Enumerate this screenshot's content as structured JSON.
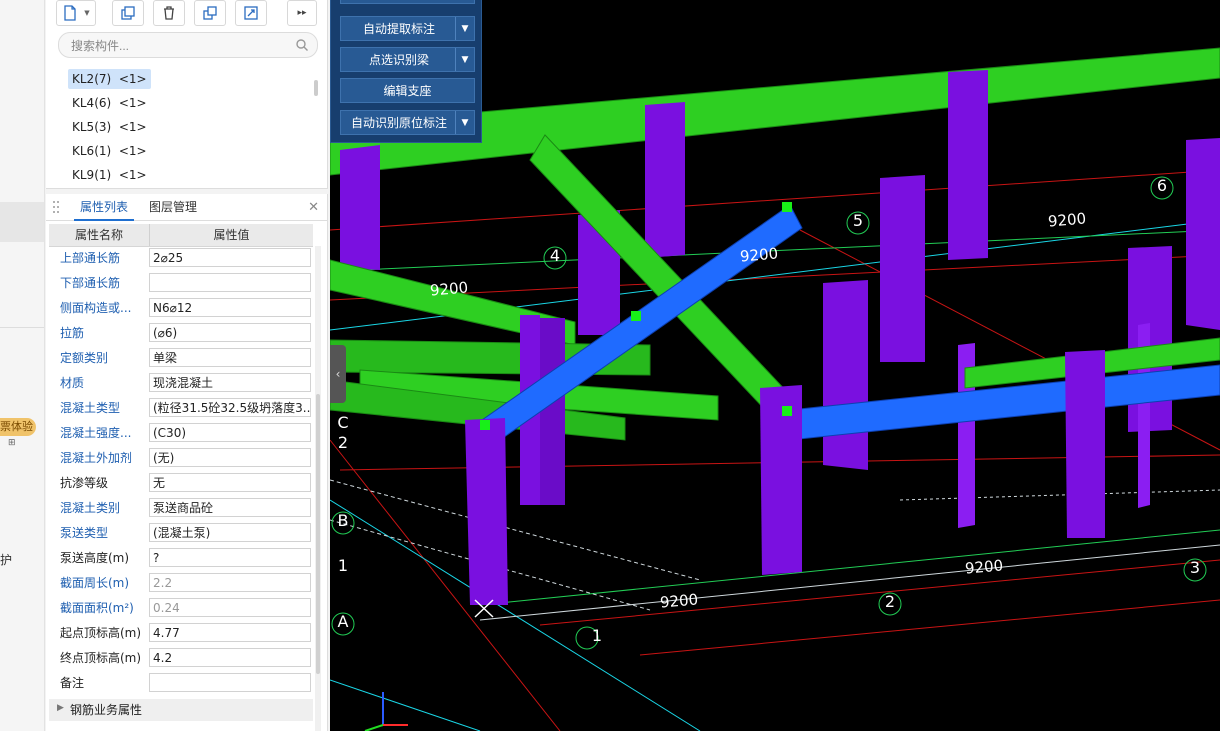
{
  "left_strip": {
    "badge": "票体验",
    "bottom_text": "护"
  },
  "component_panel": {
    "search": {
      "placeholder": "搜索构件..."
    },
    "items": [
      {
        "label": "KL2(7)  <1>",
        "selected": true
      },
      {
        "label": "KL4(6)  <1>",
        "selected": false
      },
      {
        "label": "KL5(3)  <1>",
        "selected": false
      },
      {
        "label": "KL6(1)  <1>",
        "selected": false
      },
      {
        "label": "KL9(1)  <1>",
        "selected": false
      }
    ]
  },
  "property_panel": {
    "tabs": [
      "属性列表",
      "图层管理"
    ],
    "columns": [
      "属性名称",
      "属性值"
    ],
    "rows": [
      {
        "name": "上部通长筋",
        "value": "2⌀25",
        "name_color": "blue"
      },
      {
        "name": "下部通长筋",
        "value": "",
        "name_color": "blue"
      },
      {
        "name": "侧面构造或...",
        "value": "N6⌀12",
        "name_color": "blue"
      },
      {
        "name": "拉筋",
        "value": "(⌀6)",
        "name_color": "blue"
      },
      {
        "name": "定额类别",
        "value": "单梁",
        "name_color": "blue"
      },
      {
        "name": "材质",
        "value": "现浇混凝土",
        "name_color": "blue"
      },
      {
        "name": "混凝土类型",
        "value": "(粒径31.5砼32.5级坍落度3...",
        "name_color": "blue"
      },
      {
        "name": "混凝土强度...",
        "value": "(C30)",
        "name_color": "blue"
      },
      {
        "name": "混凝土外加剂",
        "value": "(无)",
        "name_color": "blue"
      },
      {
        "name": "抗渗等级",
        "value": "无",
        "name_color": "black"
      },
      {
        "name": "混凝土类别",
        "value": "泵送商品砼",
        "name_color": "blue"
      },
      {
        "name": "泵送类型",
        "value": "(混凝土泵)",
        "name_color": "blue"
      },
      {
        "name": "泵送高度(m)",
        "value": "?",
        "name_color": "black"
      },
      {
        "name": "截面周长(m)",
        "value": "2.2",
        "name_color": "blue",
        "value_grey": true
      },
      {
        "name": "截面面积(m²)",
        "value": "0.24",
        "name_color": "blue",
        "value_grey": true
      },
      {
        "name": "起点顶标高(m)",
        "value": "4.77",
        "name_color": "black"
      },
      {
        "name": "终点顶标高(m)",
        "value": "4.2",
        "name_color": "black"
      },
      {
        "name": "备注",
        "value": "",
        "name_color": "black"
      }
    ],
    "sections": [
      "钢筋业务属性"
    ]
  },
  "tool_menu": {
    "buttons": [
      {
        "label": "自动提取标注",
        "dropdown": true
      },
      {
        "label": "点选识别梁",
        "dropdown": true
      },
      {
        "label": "编辑支座",
        "dropdown": false
      },
      {
        "label": "自动识别原位标注",
        "dropdown": true
      }
    ]
  },
  "viewport": {
    "dimension_labels": [
      "9200",
      "9200",
      "9200",
      "9200",
      "9200"
    ],
    "axis_numbers": [
      "1",
      "2",
      "3",
      "4",
      "5",
      "6"
    ],
    "axis_letters": [
      "A",
      "B",
      "C"
    ],
    "axis_side_numbers": [
      "1",
      "2"
    ],
    "colors": {
      "column": "#7a10e0",
      "beam_green": "#2ecf22",
      "beam_selected": "#1f6bff",
      "grid_red": "#c81414",
      "grid_cyan": "#1ad6e6",
      "grid_green": "#22cc55",
      "background": "#000000"
    }
  }
}
